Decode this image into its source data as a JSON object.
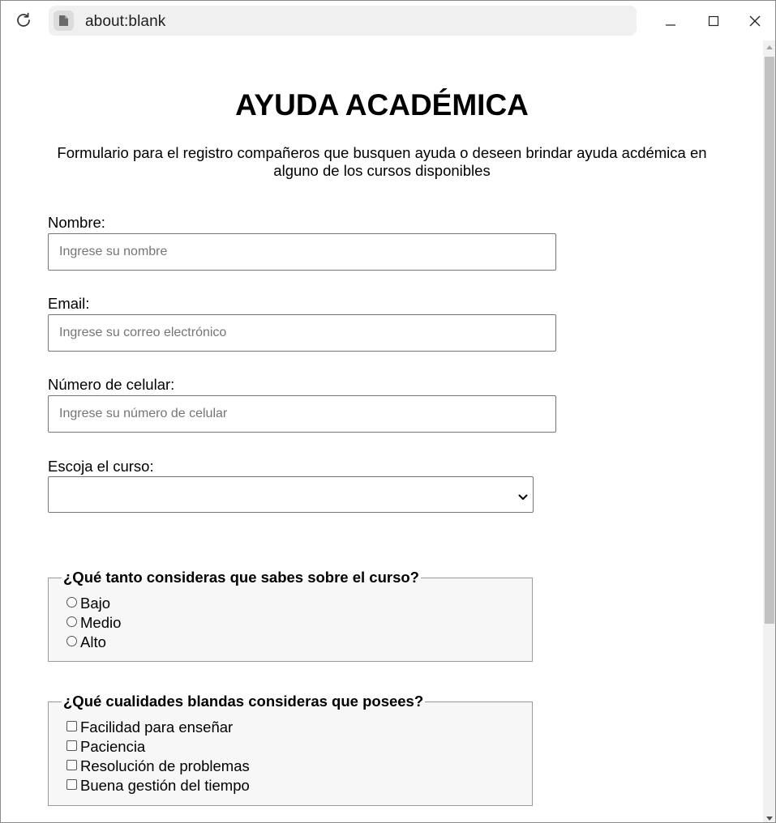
{
  "browser": {
    "url": "about:blank"
  },
  "form": {
    "title": "AYUDA ACADÉMICA",
    "subtitle": "Formulario para el registro compañeros que busquen ayuda o deseen brindar ayuda acdémica en alguno de los cursos disponibles",
    "name": {
      "label": "Nombre:",
      "placeholder": "Ingrese su nombre",
      "value": ""
    },
    "email": {
      "label": "Email:",
      "placeholder": "Ingrese su correo electrónico",
      "value": ""
    },
    "phone": {
      "label": "Número de celular:",
      "placeholder": "Ingrese su número de celular",
      "value": ""
    },
    "course": {
      "label": "Escoja el curso:",
      "selected": ""
    },
    "knowledge": {
      "legend": "¿Qué tanto consideras que sabes sobre el curso?",
      "options": [
        "Bajo",
        "Medio",
        "Alto"
      ]
    },
    "soft_skills": {
      "legend": "¿Qué cualidades blandas consideras que posees?",
      "options": [
        "Facilidad para enseñar",
        "Paciencia",
        "Resolución de problemas",
        "Buena gestión del tiempo"
      ]
    }
  }
}
